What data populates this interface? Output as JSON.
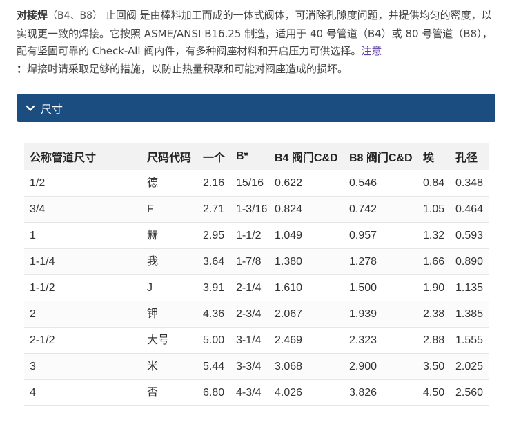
{
  "intro": {
    "title": "对接焊",
    "title_codes": "（B4、B8）",
    "line1_rest": " 止回阀 是由棒料加工而成的一体式阀体，可消除孔隙度问题，并提供均匀的密度，以实现更一致的焊接。它按照 ASME/ANSI B16.25 制造，适用于 40 号管道（B4）或 80 号管道（B8），配有坚固可靠的 Check-All 阀内件，有多种阀座材料和开启压力可供选择。",
    "note_link": "注意",
    "note_colon": "：",
    "note_text": "焊接时请采取足够的措施，以防止热量积聚和可能对阀座造成的损坏。"
  },
  "accordion": {
    "label": "尺寸",
    "icon": "chevron-down-icon",
    "color": "#1b4d80"
  },
  "table": {
    "headers": [
      "公称管道尺寸",
      "尺码代码",
      "一个",
      "B*",
      "B4 阀门C&D",
      "B8 阀门C&D",
      "埃",
      "孔径"
    ],
    "rows": [
      [
        "1/2",
        "德",
        "2.16",
        "15/16",
        "0.622",
        "0.546",
        "0.84",
        "0.348"
      ],
      [
        "3/4",
        "F",
        "2.71",
        "1-3/16",
        "0.824",
        "0.742",
        "1.05",
        "0.464"
      ],
      [
        "1",
        "赫",
        "2.95",
        "1-1/2",
        "1.049",
        "0.957",
        "1.32",
        "0.593"
      ],
      [
        "1-1/4",
        "我",
        "3.64",
        "1-7/8",
        "1.380",
        "1.278",
        "1.66",
        "0.890"
      ],
      [
        "1-1/2",
        "J",
        "3.91",
        "2-1/4",
        "1.610",
        "1.500",
        "1.90",
        "1.135"
      ],
      [
        "2",
        "钾",
        "4.36",
        "2-3/4",
        "2.067",
        "1.939",
        "2.38",
        "1.385"
      ],
      [
        "2-1/2",
        "大号",
        "5.00",
        "3-1/4",
        "2.469",
        "2.323",
        "2.88",
        "1.555"
      ],
      [
        "3",
        "米",
        "5.44",
        "3-3/4",
        "3.068",
        "2.900",
        "3.50",
        "2.025"
      ],
      [
        "4",
        "否",
        "6.80",
        "4-3/4",
        "4.026",
        "3.826",
        "4.50",
        "2.560"
      ]
    ]
  }
}
